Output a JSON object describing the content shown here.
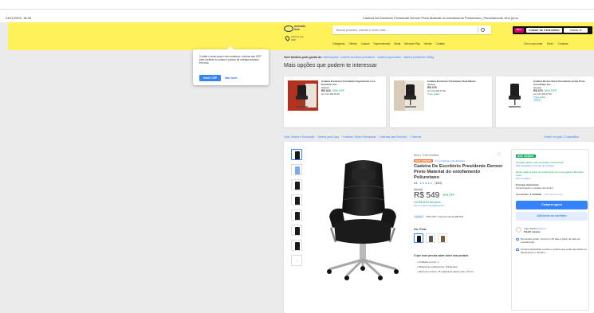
{
  "print": {
    "date": "24/11/2026, 18:28",
    "title": "Cadeira De Escritório Presidente Denver Preto Material do estofamento Poliuretano | Parcelamento sem juros"
  },
  "header": {
    "logo_text": "mercado livre",
    "cep_line1": "Informe seu",
    "cep_line2": "CEP",
    "search_placeholder": "Buscar produtos, marcas e muito mais…",
    "nav": [
      "Categorias",
      "Ofertas",
      "Cupons",
      "Supermercado",
      "Moda",
      "Mercado Play",
      "Vender",
      "Contato"
    ],
    "promo": {
      "tag": "MELI+",
      "main": "COMBO DE STREAMING",
      "side": "ASSINE JÁ"
    },
    "account": [
      "Crie a sua conta",
      "Entre",
      "Compras"
    ]
  },
  "popup": {
    "message": "Confira o custo para o seu endereço. Informe seu CEP para verificar os custos e prazos de entrega precisos em tudo.",
    "primary": "Inserir CEP",
    "secondary": "Mais tarde"
  },
  "related": {
    "note_prefix": "Você também pode gostar de:",
    "note_links": "Interessados · cadeira escritório presidente · cadeira ergonomica · cadeira presidente 150kg",
    "heading": "Mais opções que podem te interessar",
    "cards": [
      {
        "name": "Cadeira Escritório Presidente Ergonômica Lore Escritório Ca…",
        "orig": "R$ 629",
        "price": "R$ 419",
        "off": "33% OFF",
        "inst": "em 10x R$ 41,90",
        "ship": ""
      },
      {
        "name": "Cadeira Escritório Presidente Tecla Master",
        "orig": "R$ 649",
        "price": "R$ 479",
        "off": "",
        "inst": "em 10x R$ 47,90",
        "ship": "Frete grátis"
      },
      {
        "name": "Cadeira De Escritório Presidente Jenny Preto Com Braço Ca…",
        "orig": "R$ 729",
        "price": "R$ 479",
        "off": "34% OFF",
        "inst": "em 10x R$ 47,90",
        "ship": "Frete grátis",
        "badge": "FULL"
      }
    ]
  },
  "breadcrumb": [
    "Casa, Móveis e Decoração",
    "Móveis para Casa",
    "Cadeiras, Sofás e Banquetas",
    "Cadeiras para Escritório",
    "Cadeiras"
  ],
  "breadcrumb_right": "Vender um igual | Compartilhar",
  "product": {
    "condition": "Novo | +1mil vendidos",
    "tag": "MAIS VENDIDO",
    "tag_text": "1º em Cadeiras para Escritório",
    "title": "Cadeira De Escritório Presidente Denver Preto Material do estofamento Poliuretano",
    "rating_value": "4.6",
    "stars": "★★★★★",
    "rating_count": "(4911)",
    "old_price": "R$ 899",
    "price": "R$ 549",
    "price_off": "39% OFF",
    "installments": "10x R$ 54,90 sem juros",
    "payment_link": "Ver os meios de pagamento",
    "coupon_badge": "Cupom",
    "coupon_text": "15% OFF. Compra mínima R$ 250.",
    "color_label": "Cor: Preto",
    "know_title": "O que você precisa saber sobre este produto",
    "bullets": [
      "Unidades por kit: 1.",
      "Material do estofamento: Poliuretano.",
      "Altura ao mínimo: 75 a altura de ajuste (mín.) 75 cm."
    ]
  },
  "buybox": {
    "badge": "MAIS VENDIDO",
    "ship_free": "Chegará grátis entre amanhã e quarta-feira",
    "ship_link": "Mais detalhes e formas de entrega",
    "pickup": "Retire grátis a partir de quarta-feira em uma agência Mercado Livre",
    "pickup_link": "Ver no mapa",
    "stock": "Estoque disponível",
    "stock_sub": "Armazenado e enviado pelo FULL",
    "qty_label": "Quantidade:",
    "qty_value": "1 unidade",
    "qty_avail": "(+50 disponíveis)",
    "buy": "Comprar agora",
    "cart": "Adicionar ao carrinho",
    "seller_prefix": "Loja oficial",
    "seller_name": "Flexform",
    "seller_sub": "Flexfit vendas",
    "protect1": "Devolução grátis. Você tem 30 dias a partir da data de recebimento.",
    "protect2": "Compra Garantida, receba o produto que está esperando ou devolvemos o dinheiro."
  },
  "colors": {
    "accent": "#3483fa",
    "yellow": "#fff159",
    "green": "#00a650",
    "orange": "#ff7733"
  }
}
